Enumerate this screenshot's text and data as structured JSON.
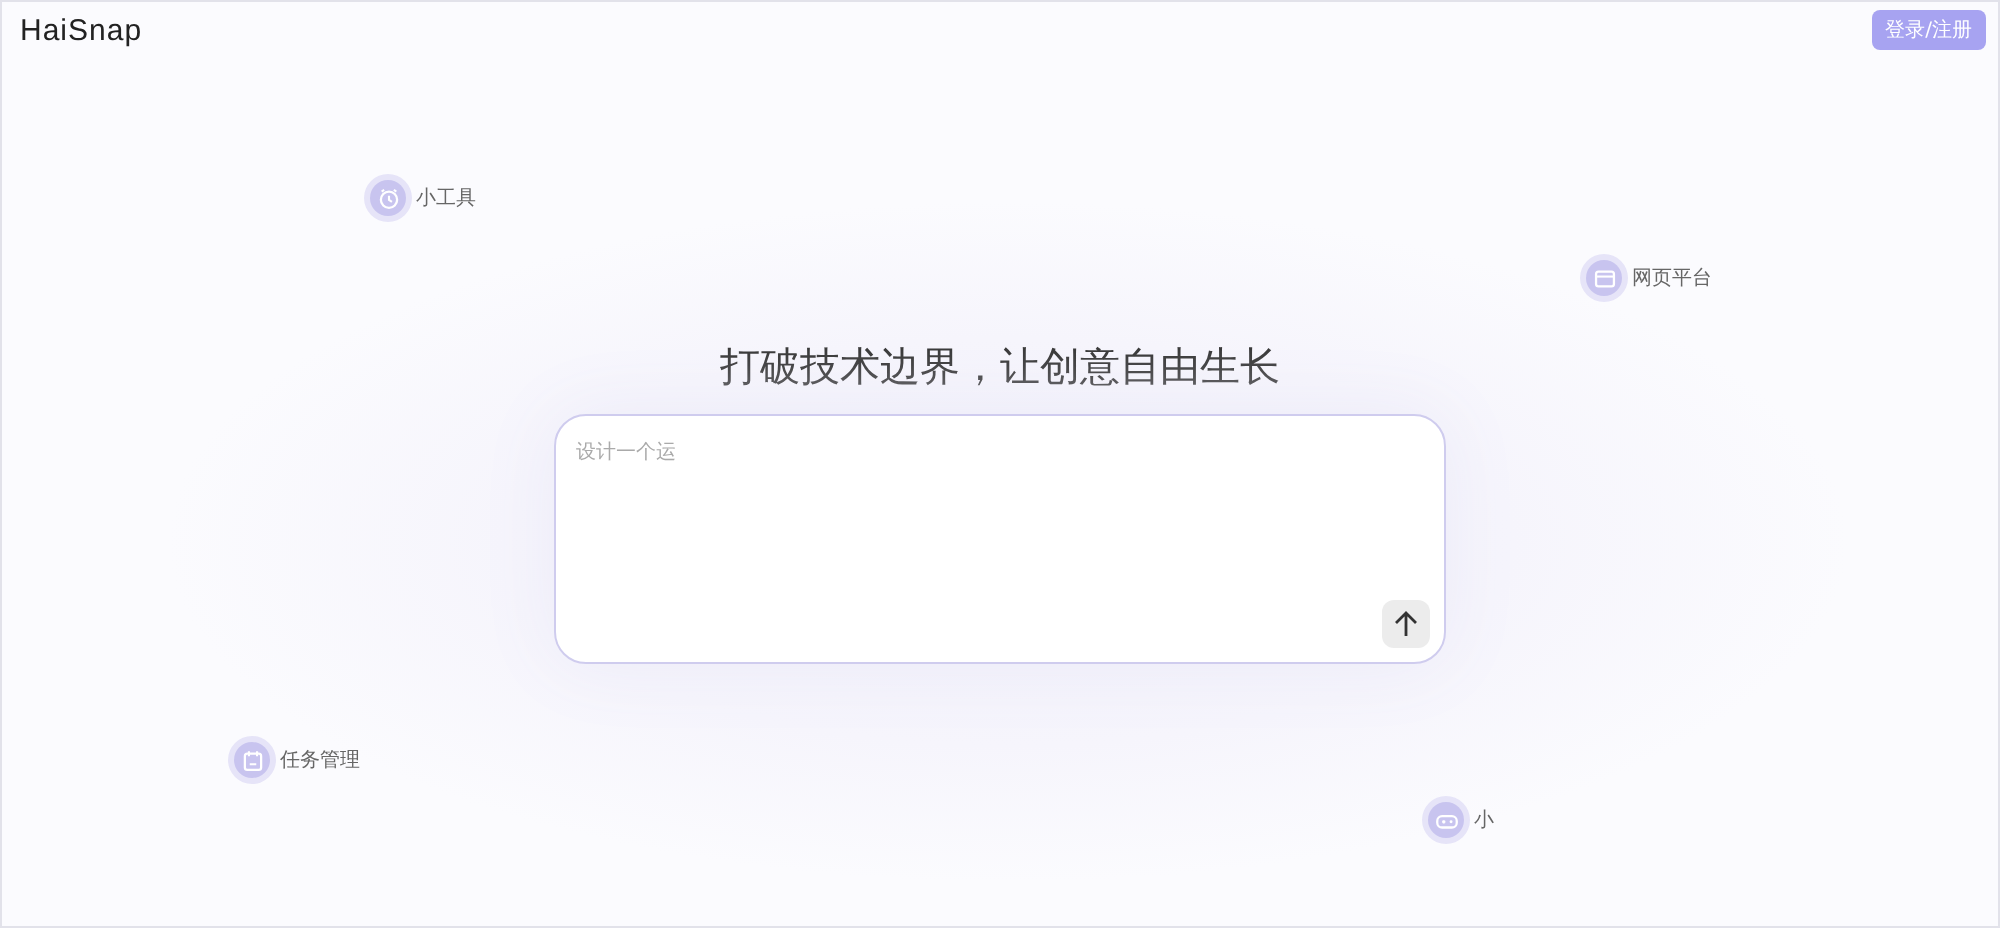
{
  "header": {
    "logo": "HaiSnap",
    "login_button": "登录/注册"
  },
  "floating_tags": [
    {
      "kind": "clock",
      "label": "小工具"
    },
    {
      "kind": "browser",
      "label": "网页平台"
    },
    {
      "kind": "calendar",
      "label": "任务管理"
    },
    {
      "kind": "gamepad",
      "label": "小"
    }
  ],
  "headline": "打破技术边界，让创意自由生长",
  "prompt": {
    "placeholder": "设计一个运"
  }
}
